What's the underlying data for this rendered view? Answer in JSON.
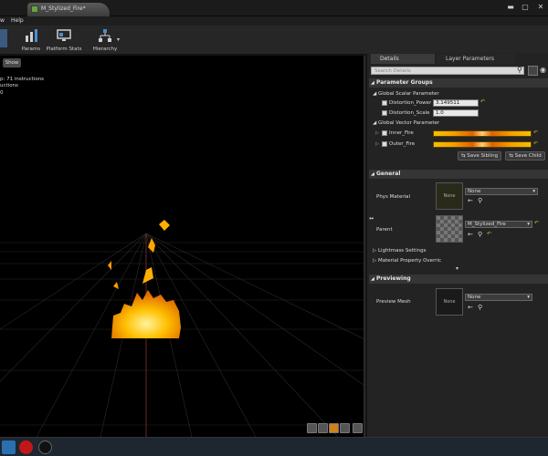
{
  "window": {
    "tab_label": "M_Stylized_Fire*"
  },
  "menubar": {
    "items": [
      "w",
      "Help"
    ]
  },
  "toolbar": {
    "buttons": [
      {
        "label": "Params"
      },
      {
        "label": "Platform Stats"
      },
      {
        "label": "Hierarchy"
      }
    ]
  },
  "viewport": {
    "show_label": "Show",
    "stats": [
      "p: 71 instructions",
      "uctions",
      "0"
    ]
  },
  "panel": {
    "tabs": [
      "Details",
      "Layer Parameters"
    ],
    "search_placeholder": "Search Details",
    "parameter_groups": {
      "title": "Parameter Groups",
      "scalar_group": "Global Scalar Parameter",
      "scalars": [
        {
          "name": "Distortion_Power",
          "value": "3.149511"
        },
        {
          "name": "Distortion_Scale",
          "value": "1.0"
        }
      ],
      "vector_group": "Global Vector Parameter",
      "vectors": [
        {
          "name": "Inner_Fire"
        },
        {
          "name": "Outer_Fire"
        }
      ],
      "save_sibling": "Save Sibling",
      "save_child": "Save Child"
    },
    "general": {
      "title": "General",
      "phys_material_label": "Phys Material",
      "phys_material_thumb": "None",
      "phys_material_value": "None",
      "parent_label": "Parent",
      "parent_value": "M_Stylized_Fire",
      "lightmass": "Lightmass Settings",
      "material_property": "Material Property Overric"
    },
    "previewing": {
      "title": "Previewing",
      "preview_mesh_label": "Preview Mesh",
      "preview_mesh_thumb": "None",
      "preview_mesh_value": "None"
    }
  },
  "colors": {
    "accent": "#f5a000",
    "fire": "#ffb000",
    "panel_bg": "#232323"
  }
}
